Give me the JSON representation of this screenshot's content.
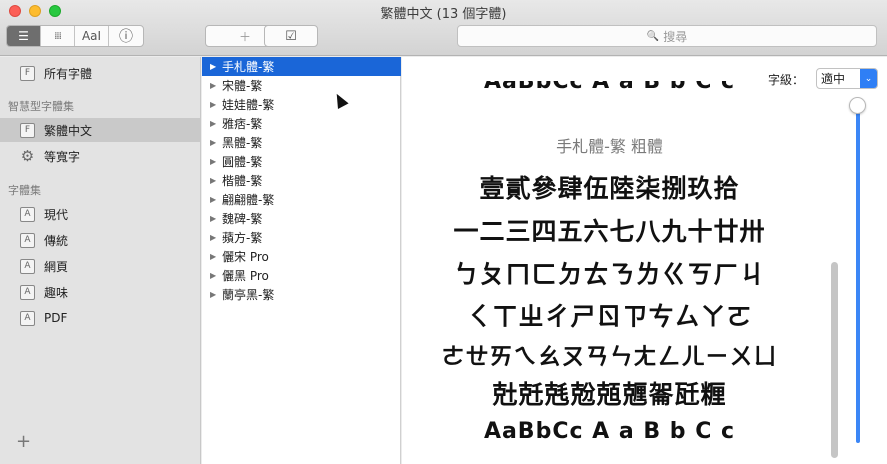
{
  "window": {
    "title": "繁體中文 (13 個字體)"
  },
  "toolbar": {
    "view_buttons": [
      {
        "icon": "list-lines-icon",
        "glyph": "☰"
      },
      {
        "icon": "grid-icon",
        "glyph": "⁞⁞⁞"
      },
      {
        "icon": "font-sample-icon",
        "glyph": "AaI"
      },
      {
        "icon": "info-icon",
        "glyph": "ⓘ"
      }
    ],
    "add_glyph": "＋",
    "check_glyph": "☑",
    "search_placeholder": "搜尋",
    "search_icon": "🔍"
  },
  "sidebar": {
    "all_fonts": "所有字體",
    "smart_header": "智慧型字體集",
    "smart_items": [
      {
        "label": "繁體中文",
        "selected": true,
        "icon": "font-box-icon"
      },
      {
        "label": "等寬字",
        "selected": false,
        "icon": "gear-icon"
      }
    ],
    "collections_header": "字體集",
    "collections": [
      "現代",
      "傳統",
      "網頁",
      "趣味",
      "PDF"
    ],
    "add_button": "+"
  },
  "font_list": {
    "items": [
      "手札體-繁",
      "宋體-繁",
      "娃娃體-繁",
      "雅痞-繁",
      "黑體-繁",
      "圓體-繁",
      "楷體-繁",
      "翩翩體-繁",
      "魏碑-繁",
      "蘋方-繁",
      "儷宋 Pro",
      "儷黑 Pro",
      "蘭亭黑-繁"
    ],
    "selected_index": 0
  },
  "preview": {
    "size_label": "字級：",
    "size_value": "適中",
    "top_partial_line": "AaBbCc  A a B b C c",
    "font_name": "手札體-繁 粗體",
    "lines": [
      "壹貳參肆伍陸柒捌玖拾",
      "一二三四五六七八九十廿卅",
      "ㄅㄆㄇㄈㄉㄊㄋㄌㄍㄎㄏㄐ",
      "ㄑㄒㄓㄔㄕㄖㄗㄘㄙㄚㄛ",
      "ㄜㄝㄞㄟㄠㄡㄢㄣㄤㄥㄦㄧㄨㄩ",
      "兙兛兞兝兡兣嗧瓩糎"
    ],
    "latin_line": "AaBbCc  A a B b C c"
  }
}
